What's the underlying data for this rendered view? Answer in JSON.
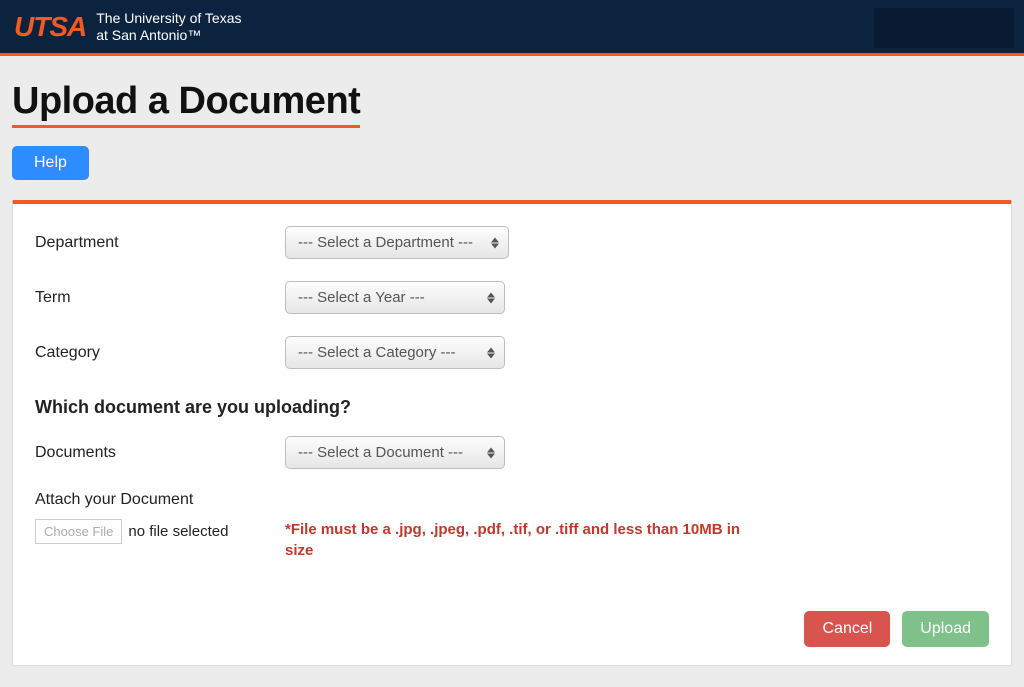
{
  "header": {
    "logo_text": "UTSA",
    "org_line1": "The University of Texas",
    "org_line2": "at San Antonio™"
  },
  "page": {
    "title": "Upload a Document",
    "help_label": "Help"
  },
  "form": {
    "department": {
      "label": "Department",
      "selected": "--- Select a Department ---"
    },
    "term": {
      "label": "Term",
      "selected": "--- Select a Year ---"
    },
    "category": {
      "label": "Category",
      "selected": "--- Select a Category ---"
    },
    "section_question": "Which document are you uploading?",
    "documents": {
      "label": "Documents",
      "selected": "--- Select a Document ---"
    },
    "attach": {
      "label": "Attach your Document",
      "choose_button": "Choose File",
      "status": "no file selected",
      "hint": "*File must be a .jpg, .jpeg, .pdf, .tif, or .tiff and less than 10MB in size"
    }
  },
  "actions": {
    "cancel": "Cancel",
    "upload": "Upload"
  }
}
